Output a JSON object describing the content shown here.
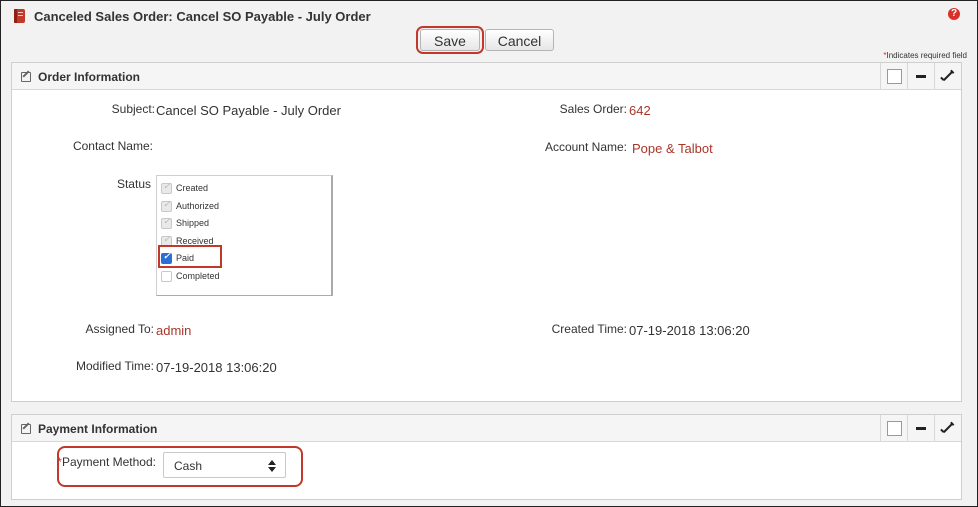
{
  "header": {
    "title": "Canceled Sales Order: Cancel SO Payable - July Order",
    "icon": "book-icon",
    "help_icon": "help-icon"
  },
  "toolbar": {
    "save_label": "Save",
    "cancel_label": "Cancel",
    "required_note_star": "*",
    "required_note": "Indicates required field"
  },
  "order_info": {
    "title": "Order Information",
    "fields": {
      "subject_label": "Subject:",
      "subject_value": "Cancel SO Payable - July Order",
      "sales_order_label": "Sales Order:",
      "sales_order_value": "642",
      "contact_name_label": "Contact Name:",
      "account_name_label": "Account Name:",
      "account_name_value": "Pope & Talbot",
      "status_label": "Status",
      "assigned_to_label": "Assigned To:",
      "assigned_to_value": "admin",
      "created_time_label": "Created Time:",
      "created_time_value": "07-19-2018 13:06:20",
      "modified_time_label": "Modified Time:",
      "modified_time_value": "07-19-2018 13:06:20"
    },
    "status_options": [
      {
        "label": "Created",
        "state": "checked-disabled"
      },
      {
        "label": "Authorized",
        "state": "checked-disabled"
      },
      {
        "label": "Shipped",
        "state": "checked-disabled"
      },
      {
        "label": "Received",
        "state": "checked-disabled"
      },
      {
        "label": "Paid",
        "state": "checked"
      },
      {
        "label": "Completed",
        "state": "unchecked"
      }
    ]
  },
  "payment_info": {
    "title": "Payment Information",
    "payment_method_star": "*",
    "payment_method_label": "Payment Method:",
    "payment_method_value": "Cash"
  },
  "colors": {
    "accent_red": "#c0392b",
    "link": "#a8362a",
    "checkbox_blue": "#2a6fd6"
  }
}
